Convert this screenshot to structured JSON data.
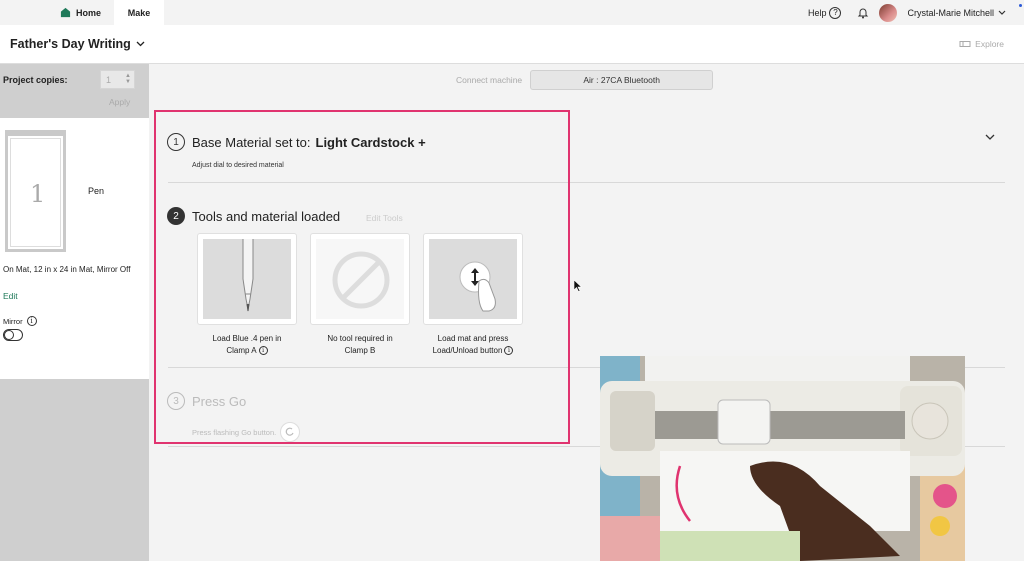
{
  "nav": {
    "home_label": "Home",
    "make_label": "Make",
    "help_label": "Help",
    "help_icon_char": "?",
    "user_name": "Crystal-Marie Mitchell"
  },
  "project": {
    "title": "Father's Day Writing",
    "explore_label": "Explore"
  },
  "sidebar": {
    "copies_label": "Project copies:",
    "copies_value": "1",
    "apply_label": "Apply",
    "mat_number": "1",
    "tool_label": "Pen",
    "mat_description": "On Mat, 12 in x 24 in Mat, Mirror Off",
    "edit_label": "Edit",
    "mirror_label": "Mirror",
    "mirror_on": false
  },
  "machine": {
    "label": "Connect machine",
    "value": "Air : 27CA Bluetooth"
  },
  "steps": {
    "step1": {
      "number": "1",
      "prefix": "Base Material set to:",
      "material": "Light Cardstock +",
      "subtitle": "Adjust dial to desired material"
    },
    "step2": {
      "number": "2",
      "title": "Tools and material loaded",
      "edit_tools": "Edit Tools",
      "tools": [
        {
          "caption_line1": "Load Blue .4 pen in",
          "caption_line2": "Clamp A",
          "icon": "pen-icon"
        },
        {
          "caption_line1": "No tool required in",
          "caption_line2": "Clamp B",
          "icon": "no-tool-icon"
        },
        {
          "caption_line1": "Load mat and press",
          "caption_line2": "Load/Unload button",
          "icon": "load-unload-icon"
        }
      ]
    },
    "step3": {
      "number": "3",
      "title": "Press Go",
      "subtitle": "Press flashing Go button."
    }
  },
  "colors": {
    "accent_green": "#1f7a5a",
    "highlight_pink": "#e0336f"
  }
}
